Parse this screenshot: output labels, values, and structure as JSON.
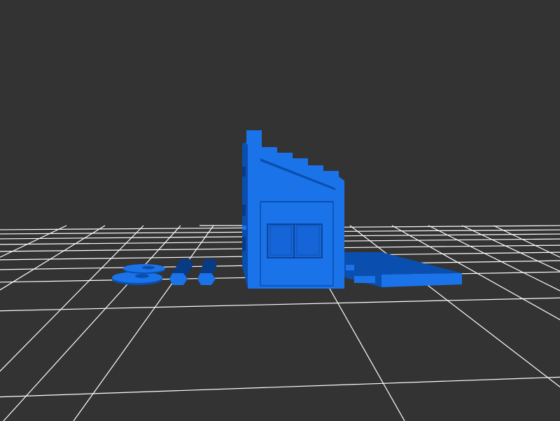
{
  "viewport": {
    "background": "#333333",
    "grid_color": "#ffffff",
    "model_color": "#1a73e8",
    "model_shadow": "#0a4fb0",
    "model_dark": "#083b86"
  },
  "scene": {
    "objects": [
      "wall-panel-with-stepped-top-and-window",
      "wedge-ramp-part",
      "washer-parts",
      "hex-peg-parts"
    ]
  }
}
